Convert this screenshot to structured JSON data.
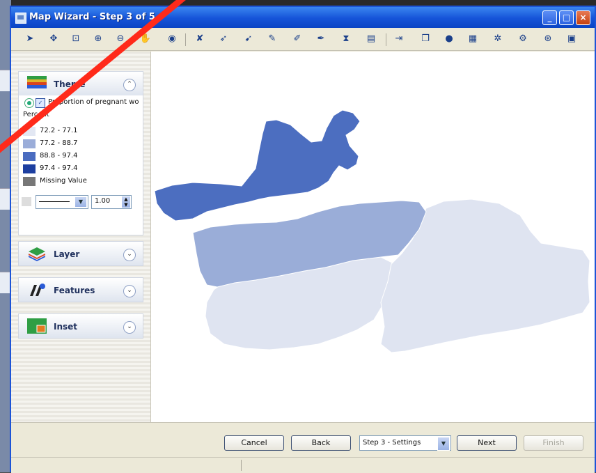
{
  "window": {
    "title": "Map Wizard - Step 3 of 5",
    "controls": [
      "_",
      "□",
      "×"
    ]
  },
  "toolbar": {
    "icons": [
      "select-arrow-icon",
      "pan-center-icon",
      "zoom-box-icon",
      "zoom-in-icon",
      "zoom-out-icon",
      "hand-pan-icon",
      "globe-icon",
      "select-tool-icon",
      "pointer-icon",
      "pointer-plus-icon",
      "pencil-icon",
      "draw-icon",
      "edit-shape-icon",
      "measure-icon",
      "table-icon",
      "export-icon",
      "copy-map-icon",
      "info-icon",
      "layout-icon",
      "labels-icon",
      "settings-icon",
      "zoom-extent-icon",
      "window-icon"
    ]
  },
  "sidebar": {
    "theme_panel": {
      "title": "Theme",
      "theme_name": "Proportion of pregnant women",
      "units_label": "Percent",
      "legend": [
        {
          "range": "72.2 - 77.1",
          "color": "#e2e7f3"
        },
        {
          "range": "77.2 - 88.7",
          "color": "#9badd9"
        },
        {
          "range": "88.8 - 97.4",
          "color": "#4a6cc0"
        },
        {
          "range": "97.4 - 97.4",
          "color": "#1d3fa0"
        },
        {
          "range": "Missing Value",
          "color": "#777777"
        }
      ],
      "line_width": "1.00"
    },
    "layer_panel": {
      "title": "Layer"
    },
    "features_panel": {
      "title": "Features"
    },
    "inset_panel": {
      "title": "Inset"
    }
  },
  "map": {
    "region_colors": {
      "light": "#dfe4f1",
      "mid": "#9aadd8",
      "dark": "#4c6ec0"
    }
  },
  "buttons": {
    "cancel": "Cancel",
    "back": "Back",
    "step_select": "Step 3 - Settings",
    "next": "Next",
    "finish": "Finish"
  }
}
